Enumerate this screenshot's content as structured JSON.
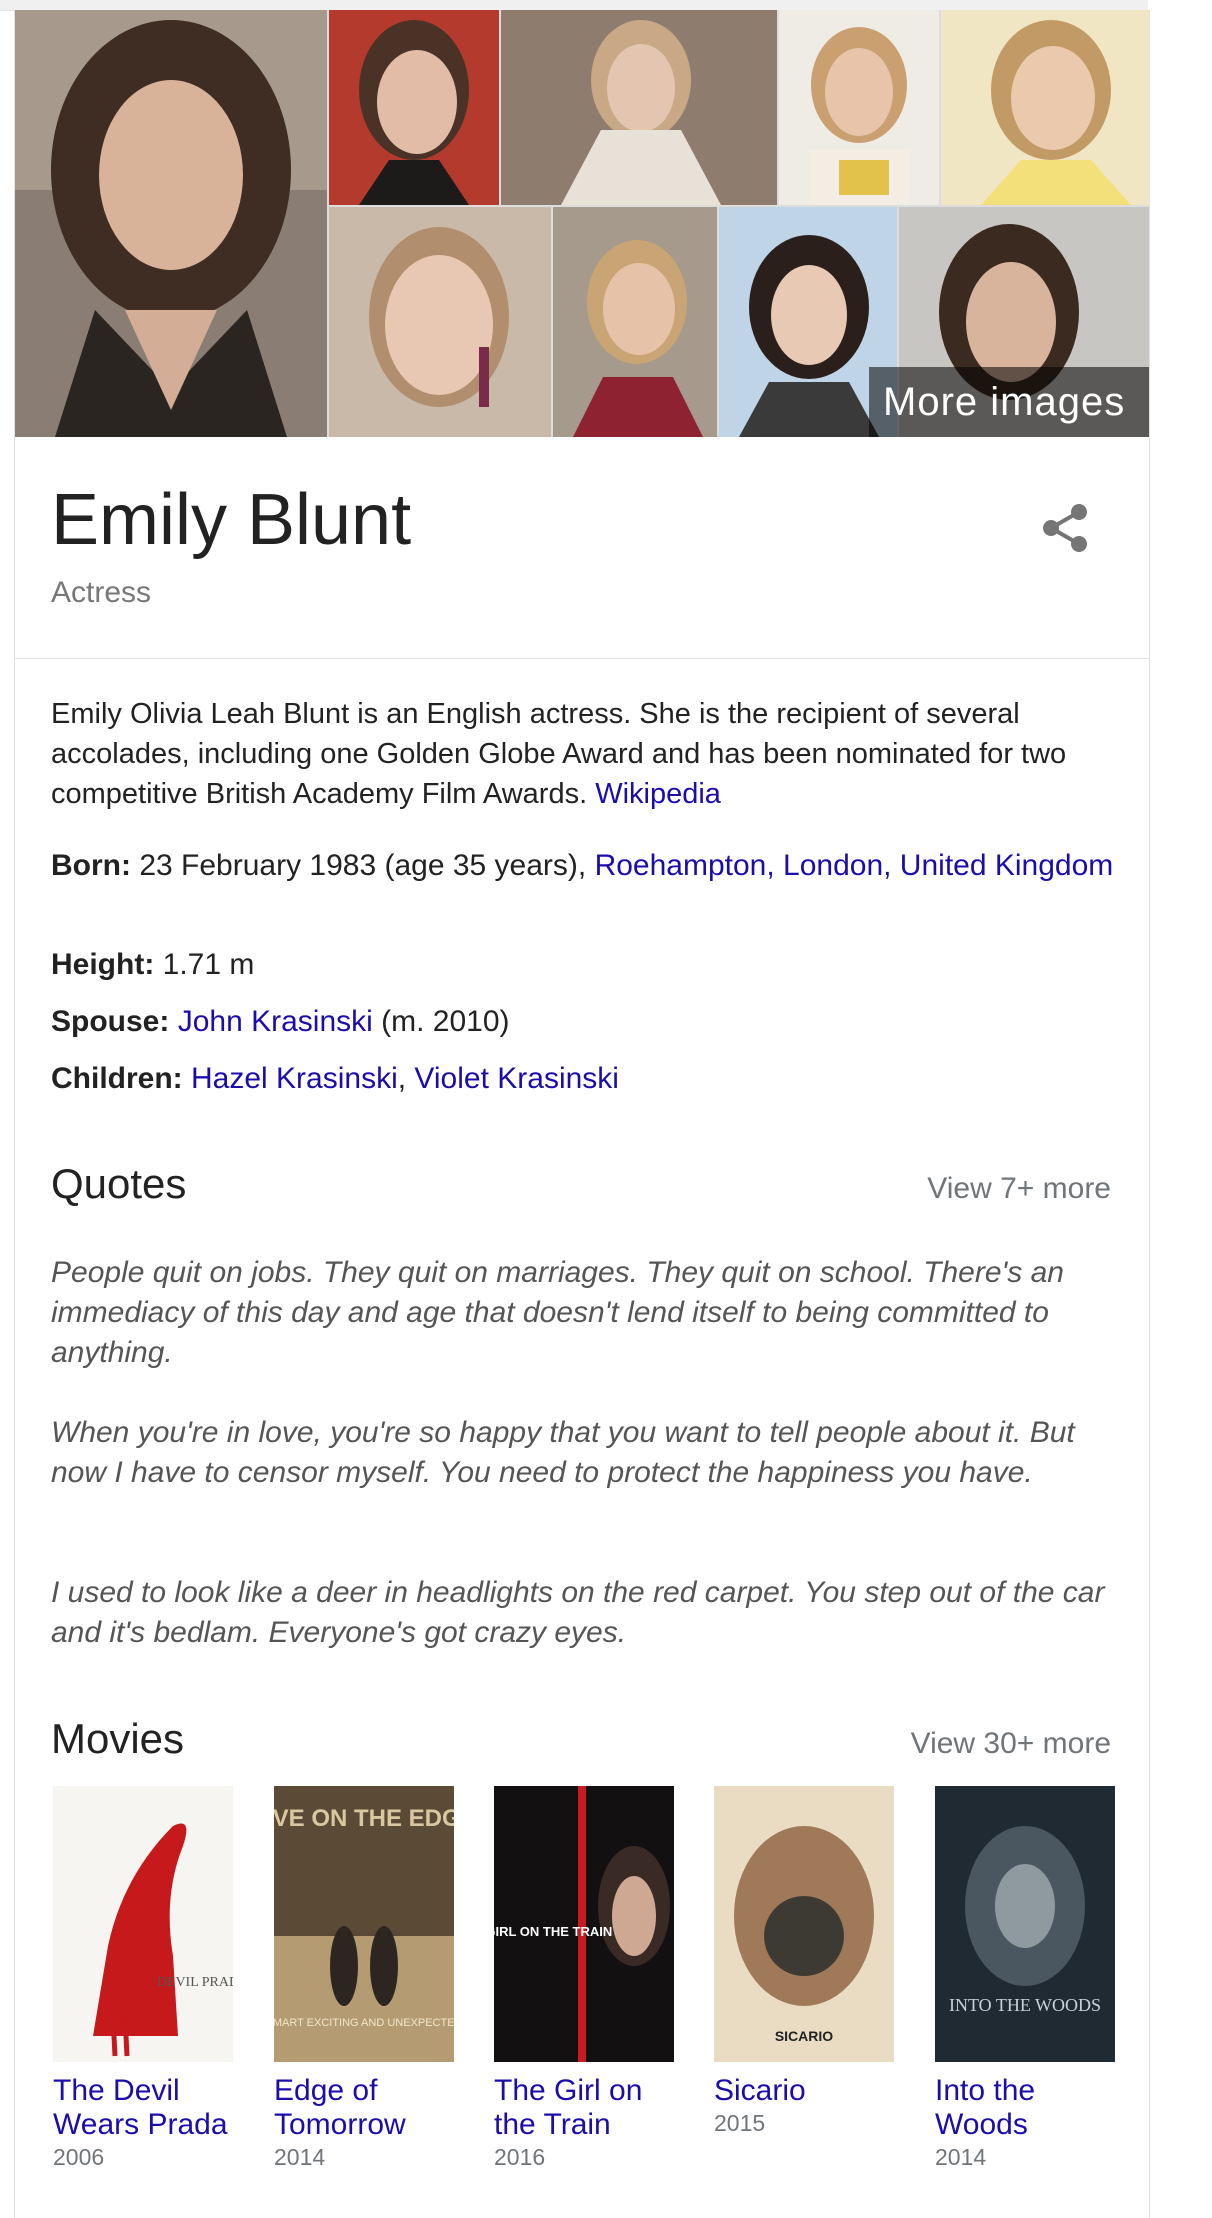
{
  "gallery": {
    "more_label": "More images"
  },
  "entity": {
    "name": "Emily Blunt",
    "type": "Actress"
  },
  "description": {
    "text": "Emily Olivia Leah Blunt is an English actress. She is the recipient of several accolades, including one Golden Globe Award and has been nominated for two competitive British Academy Film Awards. ",
    "source": "Wikipedia"
  },
  "facts": {
    "born": {
      "label": "Born:",
      "text": " 23 February 1983 (age 35 years), ",
      "link": "Roehampton, London, United Kingdom"
    },
    "height": {
      "label": "Height:",
      "text": " 1.71 m"
    },
    "spouse": {
      "label": "Spouse:",
      "link": "John Krasinski",
      "text": " (m. 2010)"
    },
    "children": {
      "label": "Children:",
      "link1": "Hazel Krasinski",
      "sep": ", ",
      "link2": "Violet Krasinski"
    }
  },
  "quotes": {
    "title": "Quotes",
    "more": "View 7+ more",
    "items": [
      "People quit on jobs. They quit on marriages. They quit on school. There's an immediacy of this day and age that doesn't lend itself to being committed to anything.",
      "When you're in love, you're so happy that you want to tell people about it. But now I have to censor myself. You need to protect the happiness you have.",
      "I used to look like a deer in headlights on the red carpet. You step out of the car and it's bedlam. Everyone's got crazy eyes."
    ]
  },
  "movies": {
    "title": "Movies",
    "more": "View 30+ more",
    "items": [
      {
        "title": "The Devil Wears Prada",
        "year": "2006",
        "poster_text": "DEVIL PRADA"
      },
      {
        "title": "Edge of Tomorrow",
        "year": "2014",
        "poster_text": "LIVE ON THE EDGE",
        "poster_sub": "SMART EXCITING AND UNEXPECTED"
      },
      {
        "title": "The Girl on the Train",
        "year": "2016",
        "poster_text": "THE GIRL ON THE TRAIN"
      },
      {
        "title": "Sicario",
        "year": "2015",
        "poster_text": "SICARIO"
      },
      {
        "title": "Into the Woods",
        "year": "2014",
        "poster_text": "INTO THE WOODS"
      }
    ]
  },
  "colors": {
    "link": "#1a0dab",
    "muted": "#70757a",
    "quote": "#555555"
  }
}
